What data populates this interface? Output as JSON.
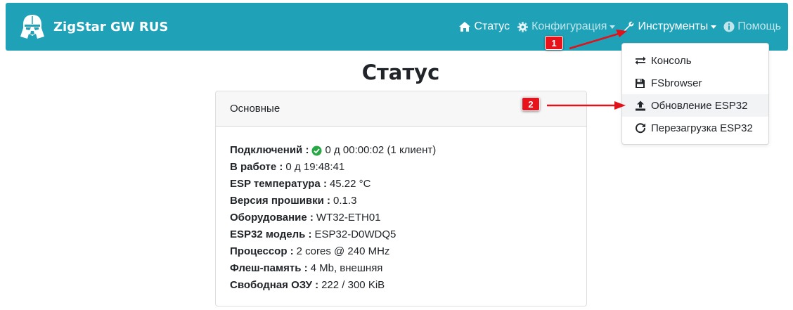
{
  "brand": {
    "title": "ZigStar GW RUS"
  },
  "nav": {
    "status": "Статус",
    "config": "Конфигурация",
    "tools": "Инструменты",
    "help": "Помощь"
  },
  "tools_menu": {
    "items": [
      {
        "label": "Консоль",
        "icon": "exchange-icon"
      },
      {
        "label": "FSbrowser",
        "icon": "floppy-icon"
      },
      {
        "label": "Обновление ESP32",
        "icon": "upload-icon"
      },
      {
        "label": "Перезагрузка ESP32",
        "icon": "refresh-icon"
      }
    ]
  },
  "page": {
    "title": "Статус"
  },
  "card": {
    "header": "Основные",
    "rows": [
      {
        "label": "Подключений :",
        "value": "0 д 00:00:02 (1 клиент)"
      },
      {
        "label": "В работе :",
        "value": "0 д 19:48:41"
      },
      {
        "label": "ESP температура :",
        "value": "45.22 °C"
      },
      {
        "label": "Версия прошивки :",
        "value": "0.1.3"
      },
      {
        "label": "Оборудование :",
        "value": "WT32-ETH01"
      },
      {
        "label": "ESP32 модель :",
        "value": "ESP32-D0WDQ5"
      },
      {
        "label": "Процессор :",
        "value": "2 cores @ 240 MHz"
      },
      {
        "label": "Флеш-память :",
        "value": "4 Mb, внешняя"
      },
      {
        "label": "Свободная ОЗУ :",
        "value": "222 / 300 KiB"
      }
    ]
  },
  "annotations": {
    "badge1": "1",
    "badge2": "2"
  },
  "colors": {
    "navbar": "#1fa2b8",
    "badge": "#e8121b",
    "check": "#28a745"
  }
}
